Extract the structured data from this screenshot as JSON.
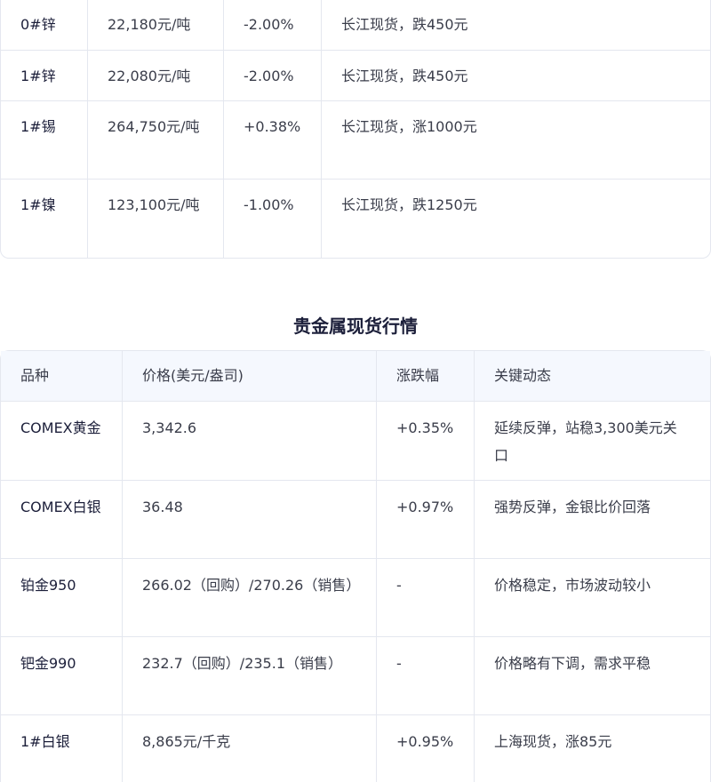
{
  "base_metals": {
    "rows": [
      {
        "name": "0#锌",
        "price": "22,180元/吨",
        "change": "-2.00%",
        "note": "长江现货，跌450元"
      },
      {
        "name": "1#锌",
        "price": "22,080元/吨",
        "change": "-2.00%",
        "note": "长江现货，跌450元"
      },
      {
        "name": "1#锡",
        "price": "264,750元/吨",
        "change": "+0.38%",
        "note": "长江现货，涨1000元"
      },
      {
        "name": "1#镍",
        "price": "123,100元/吨",
        "change": "-1.00%",
        "note": "长江现货，跌1250元"
      }
    ]
  },
  "precious": {
    "title": "贵金属现货行情",
    "headers": {
      "name": "品种",
      "price": "价格(美元/盎司)",
      "change": "涨跌幅",
      "note": "关键动态"
    },
    "rows": [
      {
        "name": "COMEX黄金",
        "price": "3,342.6",
        "change": "+0.35%",
        "note": "延续反弹，站稳3,300美元关口"
      },
      {
        "name": "COMEX白银",
        "price": "36.48",
        "change": "+0.97%",
        "note": "强势反弹，金银比价回落"
      },
      {
        "name": "铂金950",
        "price": "266.02（回购）/270.26（销售）",
        "change": "-",
        "note": "价格稳定，市场波动较小"
      },
      {
        "name": "钯金990",
        "price": "232.7（回购）/235.1（销售）",
        "change": "-",
        "note": "价格略有下调，需求平稳"
      },
      {
        "name": "1#白银",
        "price": "8,865元/千克",
        "change": "+0.95%",
        "note": "上海现货，涨85元"
      }
    ]
  }
}
